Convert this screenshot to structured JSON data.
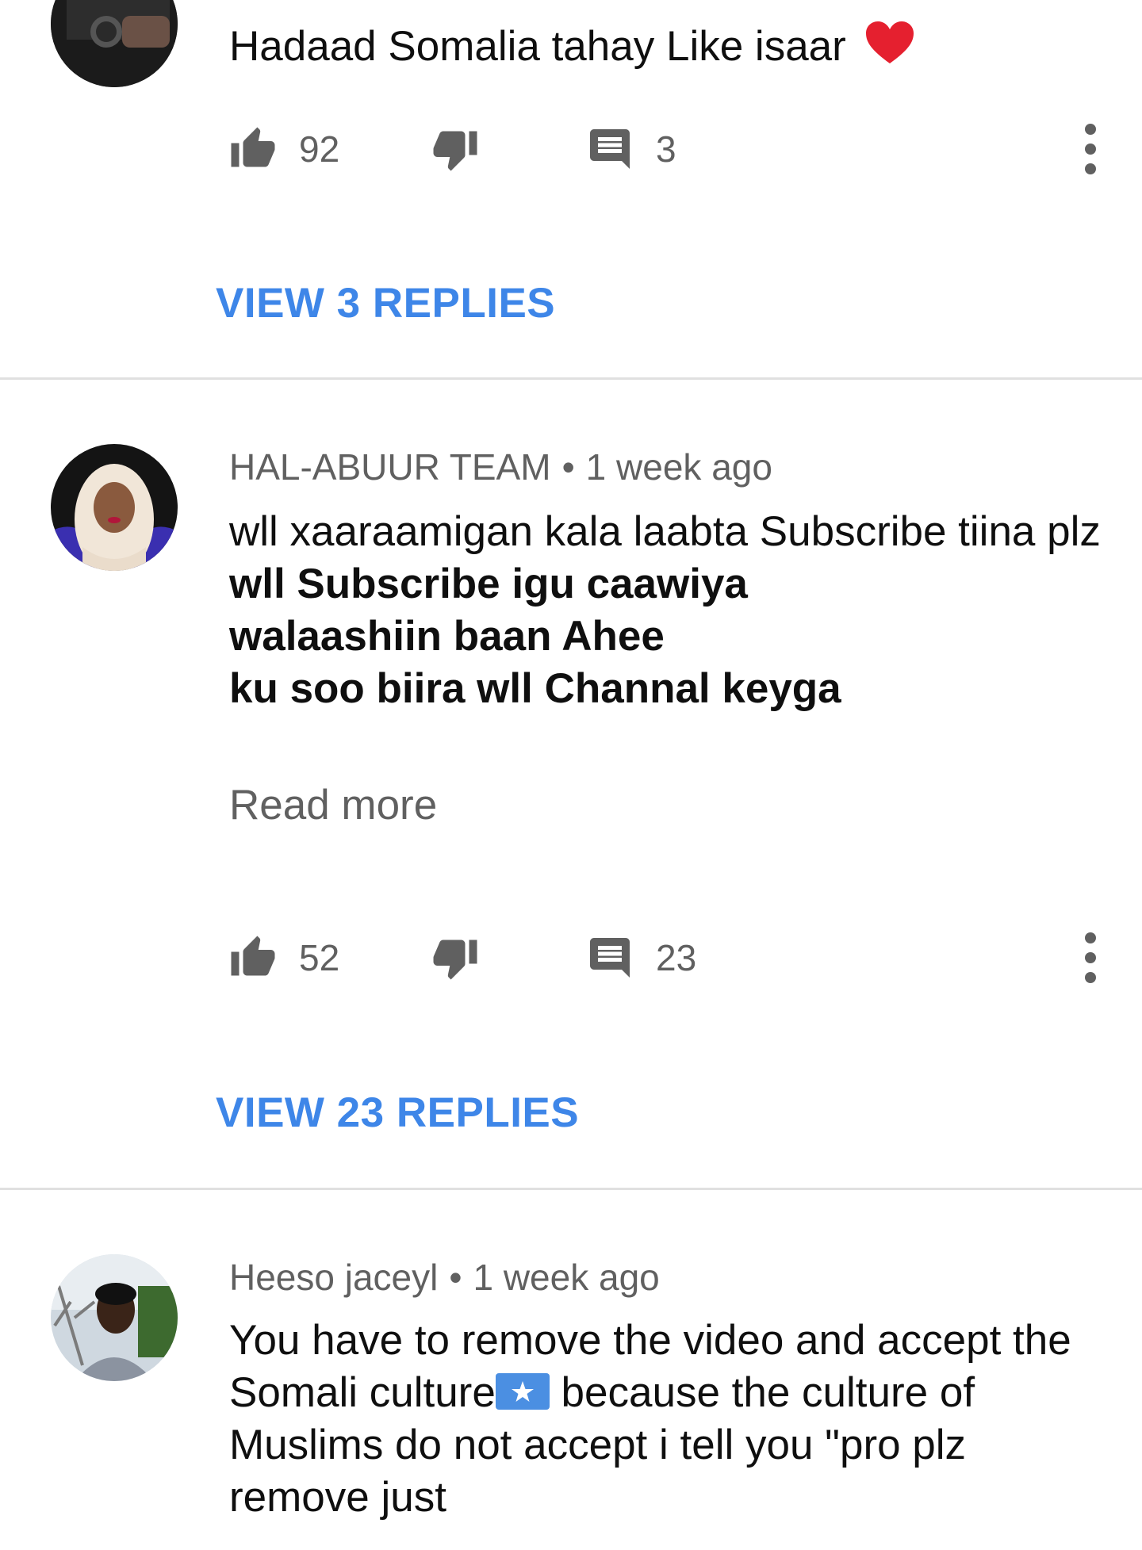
{
  "comments": [
    {
      "text": "Hadaad Somalia tahay Like isaar",
      "emoji": "❤",
      "likes": "92",
      "replies_count": "3",
      "view_replies": "VIEW 3 REPLIES"
    },
    {
      "author": "HAL-ABUUR TEAM",
      "separator": "•",
      "time": "1 week ago",
      "text": "wll xaaraamigan kala laabta Subscribe tiina plz",
      "bold_lines": [
        "wll Subscribe igu caawiya",
        "walaashiin baan Ahee",
        "ku soo biira wll Channal keyga"
      ],
      "read_more": "Read more",
      "likes": "52",
      "replies_count": "23",
      "view_replies": "VIEW 23 REPLIES"
    },
    {
      "author": "Heeso jaceyl",
      "separator": "•",
      "time": "1 week ago",
      "text_before_flag": "You have to remove the video and accept the Somali culture",
      "text_after_flag": " because  the culture of Muslims do not accept i tell you \"pro plz remove just"
    }
  ],
  "colors": {
    "link": "#3e86e8",
    "muted": "#606060",
    "divider": "#e0e0e0",
    "heart": "#e5202f"
  }
}
